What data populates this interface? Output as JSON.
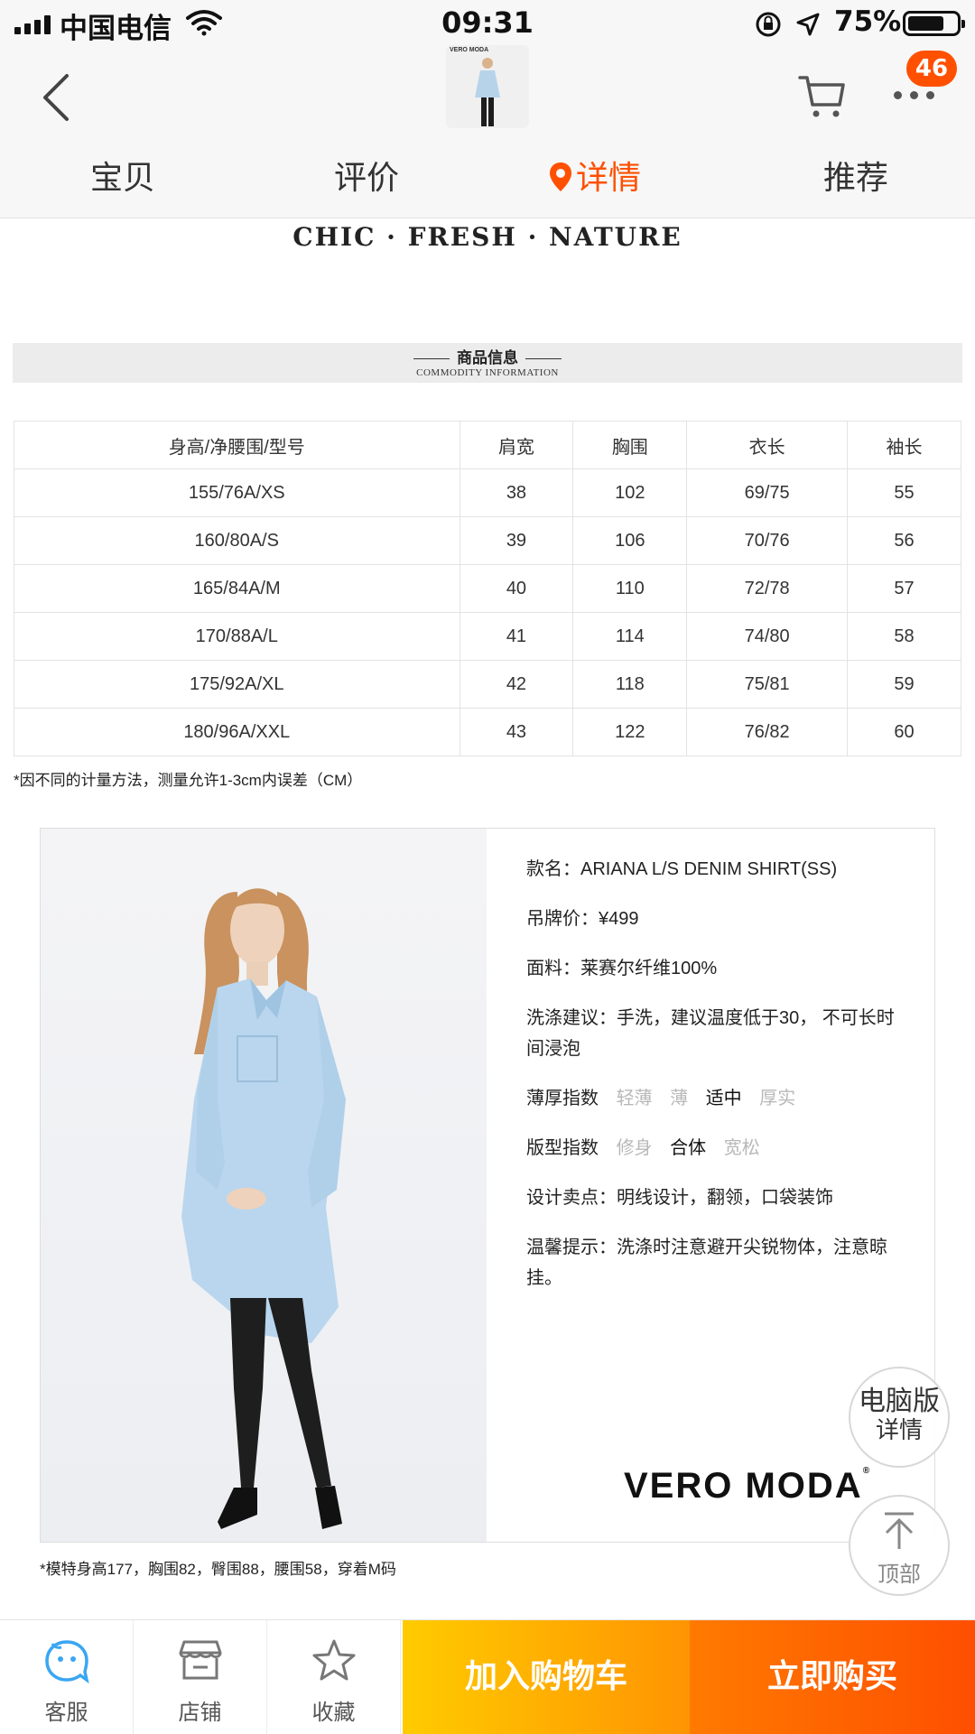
{
  "status_bar": {
    "carrier": "中国电信",
    "time": "09:31",
    "battery": "75%",
    "battery_level": 0.75
  },
  "header": {
    "thumb_brand": "VERO MODA",
    "badge_count": "46",
    "icons": [
      "back-icon",
      "cart-icon",
      "more-icon"
    ]
  },
  "tabs": [
    {
      "label": "宝贝",
      "active": false
    },
    {
      "label": "评价",
      "active": false
    },
    {
      "label": "详情",
      "active": true
    },
    {
      "label": "推荐",
      "active": false
    }
  ],
  "detail": {
    "banner": "CHIC · FRESH · NATURE",
    "section_title": "商品信息",
    "section_subtitle": "COMMODITY INFORMATION",
    "size_table": {
      "headers": [
        "身高/净腰围/型号",
        "肩宽",
        "胸围",
        "衣长",
        "袖长"
      ],
      "rows": [
        [
          "155/76A/XS",
          "38",
          "102",
          "69/75",
          "55"
        ],
        [
          "160/80A/S",
          "39",
          "106",
          "70/76",
          "56"
        ],
        [
          "165/84A/M",
          "40",
          "110",
          "72/78",
          "57"
        ],
        [
          "170/88A/L",
          "41",
          "114",
          "74/80",
          "58"
        ],
        [
          "175/92A/XL",
          "42",
          "118",
          "75/81",
          "59"
        ],
        [
          "180/96A/XXL",
          "43",
          "122",
          "76/82",
          "60"
        ]
      ]
    },
    "measure_note": "*因不同的计量方法，测量允许1-3cm内误差（CM）",
    "product_info": {
      "name": "款名：ARIANA L/S DENIM SHIRT(SS)",
      "price": "吊牌价：¥499",
      "fabric": "面料：莱赛尔纤维100%",
      "wash": "洗涤建议：手洗，建议温度低于30， 不可长时间浸泡",
      "thickness_label": "薄厚指数",
      "thickness_options": [
        "轻薄",
        "薄",
        "适中",
        "厚实"
      ],
      "thickness_selected": "适中",
      "fit_label": "版型指数",
      "fit_options": [
        "修身",
        "合体",
        "宽松"
      ],
      "fit_selected": "合体",
      "design": "设计卖点：明线设计，翻领，口袋装饰",
      "tips": "温馨提示：洗涤时注意避开尖锐物体，注意晾挂。"
    },
    "brand_logo": "VERO MODA",
    "model_note": "*模特身高177，胸围82，臀围88，腰围58，穿着M码"
  },
  "floating": {
    "desktop_line1": "电脑版",
    "desktop_line2": "详情",
    "top_label": "顶部"
  },
  "bottom_bar": {
    "service": "客服",
    "shop": "店铺",
    "favorite": "收藏",
    "add_to_cart": "加入购物车",
    "buy_now": "立即购买"
  },
  "colors": {
    "accent": "#ff5000",
    "cart_button": "#ff9402",
    "buy_button": "#fe4f00",
    "service_icon": "#3aa6f2"
  }
}
